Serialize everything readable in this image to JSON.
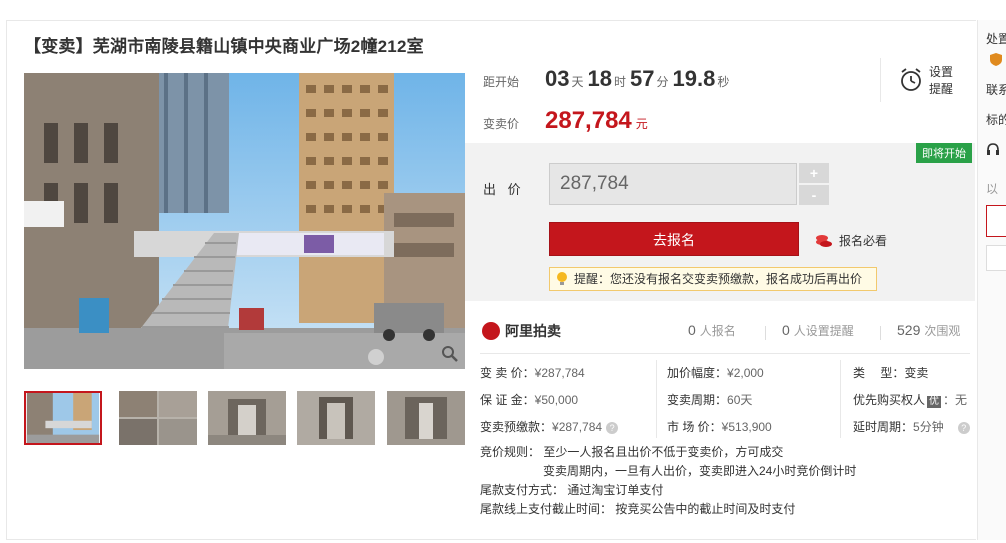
{
  "title": "【变卖】芜湖市南陵县籍山镇中央商业广场2幢212室",
  "countdown": {
    "label": "距开始",
    "days": "03",
    "days_unit": "天",
    "hours": "18",
    "hours_unit": "时",
    "minutes": "57",
    "minutes_unit": "分",
    "seconds": "19.8",
    "seconds_unit": "秒"
  },
  "reminder": {
    "label": "设置提醒",
    "icon": "alarm-clock-icon"
  },
  "price": {
    "label": "变卖价",
    "value": "287,784",
    "unit": "元"
  },
  "bid": {
    "status_tag": "即将开始",
    "label": "出 价",
    "input_value": "287,784",
    "plus": "+",
    "minus": "-",
    "signup_button": "去报名",
    "must_read": "报名必看",
    "notice": "提醒：您还没有报名交变卖预缴款，报名成功后再出价"
  },
  "stats": {
    "brand": "阿里拍卖",
    "signups": "0",
    "signups_label": "人报名",
    "reminders": "0",
    "reminders_label": "人设置提醒",
    "views": "529",
    "views_label": "次围观"
  },
  "info": {
    "price": {
      "k": "变 卖 价：",
      "v": "¥287,784"
    },
    "deposit": {
      "k": "保 证 金：",
      "v": "¥50,000"
    },
    "prepay": {
      "k": "变卖预缴款：",
      "v": "¥287,784"
    },
    "increment": {
      "k": "加价幅度：",
      "v": "¥2,000"
    },
    "period": {
      "k": "变卖周期：",
      "v": "60天"
    },
    "market": {
      "k": "市 场 价：",
      "v": "¥513,900"
    },
    "type": {
      "k": "类　 型：",
      "v": "变卖"
    },
    "priority": {
      "k": "优先购买权人",
      "badge": "优",
      "v": "：无"
    },
    "delay": {
      "k": "延时周期：",
      "v": "5分钟"
    }
  },
  "rules": {
    "line1": "竞价规则：  至少一人报名且出价不低于变卖价，方可成交",
    "line2": "变卖周期内，一旦有人出价，变卖即进入24小时竞价倒计时",
    "line3": "尾款支付方式：  通过淘宝订单支付",
    "line4": "尾款线上支付截止时间：  按竞买公告中的截止时间及时支付"
  },
  "sidebar": {
    "item1": "处置",
    "item2": "联系",
    "item3": "标的",
    "item4": "以"
  },
  "colors": {
    "accent": "#c4161c",
    "green_tag": "#2aa148"
  }
}
